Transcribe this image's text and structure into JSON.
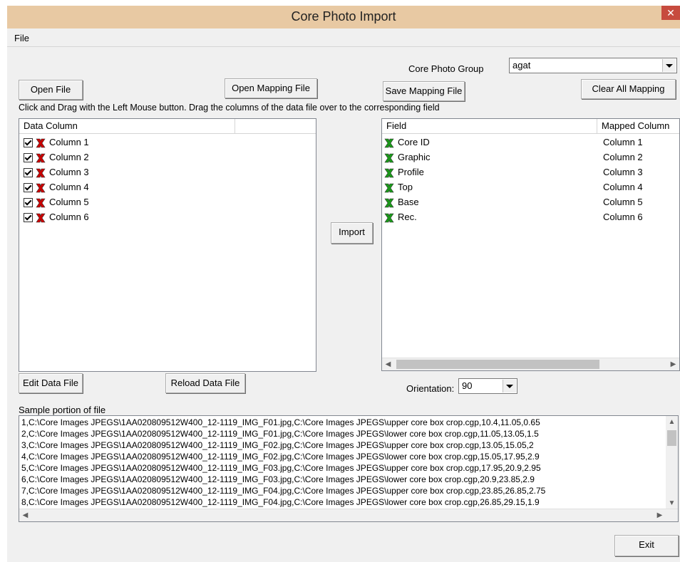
{
  "window": {
    "title": "Core Photo Import",
    "close_glyph": "✕"
  },
  "menu": {
    "file": "File"
  },
  "group": {
    "label": "Core Photo Group",
    "value": "agat"
  },
  "buttons": {
    "open_file": "Open File",
    "open_mapping": "Open Mapping File",
    "save_mapping": "Save Mapping File",
    "clear_mapping": "Clear All Mapping",
    "import": "Import",
    "edit_data": "Edit Data File",
    "reload_data": "Reload Data File",
    "exit": "Exit"
  },
  "instructions": "Click and Drag with the Left Mouse button. Drag the columns of the data file over to the corresponding field",
  "data_columns": {
    "header": "Data Column",
    "items": [
      "Column 1",
      "Column 2",
      "Column 3",
      "Column 4",
      "Column 5",
      "Column 6"
    ]
  },
  "fields": {
    "header_field": "Field",
    "header_mapped": "Mapped Column",
    "rows": [
      {
        "field": "Core ID",
        "mapped": "Column 1"
      },
      {
        "field": "Graphic",
        "mapped": "Column 2"
      },
      {
        "field": "Profile",
        "mapped": "Column 3"
      },
      {
        "field": "Top",
        "mapped": "Column 4"
      },
      {
        "field": "Base",
        "mapped": "Column 5"
      },
      {
        "field": "Rec.",
        "mapped": "Column 6"
      }
    ]
  },
  "orientation": {
    "label": "Orientation:",
    "value": "90"
  },
  "sample": {
    "label": "Sample portion of file",
    "lines": [
      "1,C:\\Core Images JPEGS\\1AA020809512W400_12-1119_IMG_F01.jpg,C:\\Core Images JPEGS\\upper core box crop.cgp,10.4,11.05,0.65",
      "2,C:\\Core Images JPEGS\\1AA020809512W400_12-1119_IMG_F01.jpg,C:\\Core Images JPEGS\\lower core box crop.cgp,11.05,13.05,1.5",
      "3,C:\\Core Images JPEGS\\1AA020809512W400_12-1119_IMG_F02.jpg,C:\\Core Images JPEGS\\upper core box crop.cgp,13.05,15.05,2",
      "4,C:\\Core Images JPEGS\\1AA020809512W400_12-1119_IMG_F02.jpg,C:\\Core Images JPEGS\\lower core box crop.cgp,15.05,17.95,2.9",
      "5,C:\\Core Images JPEGS\\1AA020809512W400_12-1119_IMG_F03.jpg,C:\\Core Images JPEGS\\upper core box crop.cgp,17.95,20.9,2.95",
      "6,C:\\Core Images JPEGS\\1AA020809512W400_12-1119_IMG_F03.jpg,C:\\Core Images JPEGS\\lower core box crop.cgp,20.9,23.85,2.9",
      "7,C:\\Core Images JPEGS\\1AA020809512W400_12-1119_IMG_F04.jpg,C:\\Core Images JPEGS\\upper core box crop.cgp,23.85,26.85,2.75",
      "8,C:\\Core Images JPEGS\\1AA020809512W400_12-1119_IMG_F04.jpg,C:\\Core Images JPEGS\\lower core box crop.cgp,26.85,29.15,1.9"
    ]
  },
  "colors": {
    "titlebar": "#e8c9a3",
    "unmapped_icon": "#cc0000",
    "mapped_icon": "#1a9a1a"
  }
}
